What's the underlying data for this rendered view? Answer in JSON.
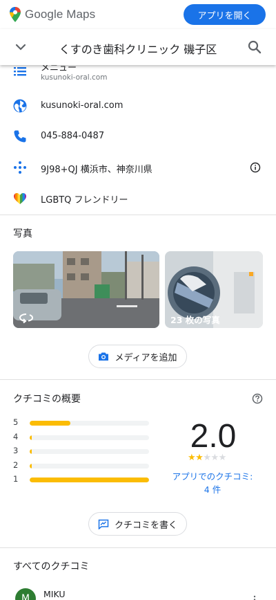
{
  "header": {
    "brand": "Google Maps",
    "open_app_label": "アプリを開く",
    "brand_color": "#1a73e8"
  },
  "search": {
    "title": "くすのき歯科クリニック 磯子区",
    "back_icon": "chevron-down-icon",
    "search_icon": "search-icon"
  },
  "info": {
    "menu_title": "メニュー",
    "menu_url": "kusunoki-oral.com",
    "website": "kusunoki-oral.com",
    "phone": "045-884-0487",
    "plus_code": "9J98+QJ 横浜市、神奈川県",
    "lgbtq": "LGBTQ フレンドリー"
  },
  "photos": {
    "title": "写真",
    "count_label": "23 枚の写真",
    "add_media_label": "メディアを追加"
  },
  "reviews_summary": {
    "title": "クチコミの概要",
    "rating": "2.0",
    "stars_filled": 2,
    "stars_total": 5,
    "link_text": "アプリでのクチコミ: 4 件",
    "distribution": [
      {
        "label": "5",
        "fraction": 0.34
      },
      {
        "label": "4",
        "fraction": 0.01
      },
      {
        "label": "3",
        "fraction": 0.01
      },
      {
        "label": "2",
        "fraction": 0.01
      },
      {
        "label": "1",
        "fraction": 1.0
      }
    ],
    "write_review_label": "クチコミを書く"
  },
  "all_reviews": {
    "title": "すべてのクチコミ",
    "first_reviewer_name": "MIKU",
    "first_reviewer_initial": "M"
  }
}
